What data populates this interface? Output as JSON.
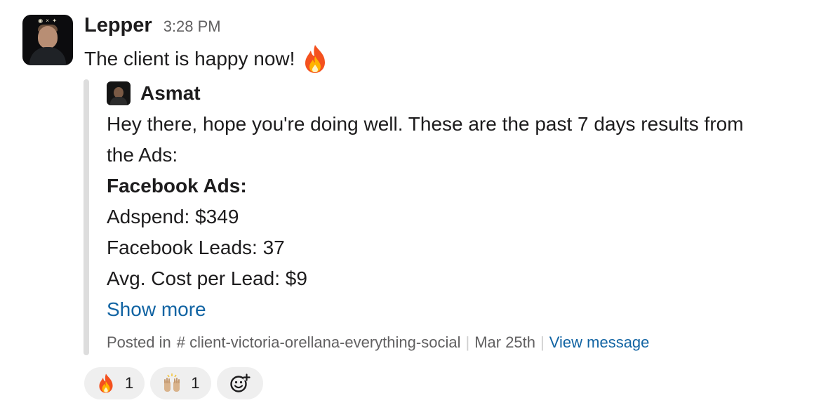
{
  "message": {
    "sender": "Lepper",
    "time": "3:28 PM",
    "text": "The client is happy now!",
    "emoji": "fire-icon"
  },
  "quote": {
    "author": "Asmat",
    "lines": [
      "Hey there, hope you're doing well. These are the past 7 days results from",
      "the Ads:",
      "Facebook Ads:",
      "Adspend: $349",
      "Facebook Leads: 37",
      "Avg. Cost per Lead: $9"
    ],
    "show_more": "Show more",
    "footer": {
      "posted_in": "Posted in",
      "channel": "# client-victoria-orellana-everything-social",
      "date": "Mar 25th",
      "view": "View message"
    }
  },
  "reactions": [
    {
      "emoji": "fire-icon",
      "count": "1"
    },
    {
      "emoji": "raised-hands-icon",
      "count": "1"
    }
  ],
  "colors": {
    "link": "#1264a3",
    "muted": "#616061",
    "quote_bar": "#dddddd",
    "reaction_bg": "#efefef"
  }
}
